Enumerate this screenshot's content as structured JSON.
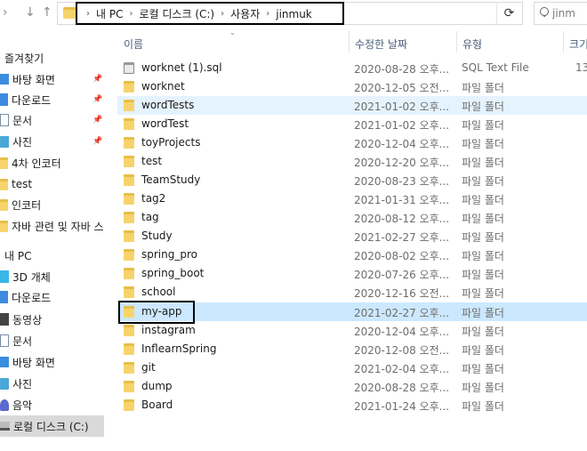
{
  "address_bar": {
    "crumbs": [
      "내 PC",
      "로컬 디스크 (C:)",
      "사용자",
      "jinmuk"
    ],
    "search_placeholder": "jinm"
  },
  "sidebar": {
    "items": [
      {
        "label": "즐겨찾기",
        "icon": "star-icon",
        "pinned": false
      },
      {
        "label": "바탕 화면",
        "icon": "desktop-icon",
        "pinned": true
      },
      {
        "label": "다운로드",
        "icon": "download-icon",
        "pinned": true
      },
      {
        "label": "문서",
        "icon": "document-icon",
        "pinned": true
      },
      {
        "label": "사진",
        "icon": "pictures-icon",
        "pinned": true
      },
      {
        "label": "4차 인코터",
        "icon": "folder-icon",
        "pinned": false
      },
      {
        "label": "test",
        "icon": "folder-icon",
        "pinned": false
      },
      {
        "label": "인코터",
        "icon": "folder-icon",
        "pinned": false
      },
      {
        "label": "자바 관련 및 자바 스",
        "icon": "folder-icon",
        "pinned": false
      },
      {
        "label": "내 PC",
        "icon": "pc-icon",
        "pinned": false
      },
      {
        "label": "3D 개체",
        "icon": "3d-objects-icon",
        "pinned": false
      },
      {
        "label": "다운로드",
        "icon": "download-icon",
        "pinned": false
      },
      {
        "label": "동영상",
        "icon": "video-icon",
        "pinned": false
      },
      {
        "label": "문서",
        "icon": "document-icon",
        "pinned": false
      },
      {
        "label": "바탕 화면",
        "icon": "desktop-icon",
        "pinned": false
      },
      {
        "label": "사진",
        "icon": "pictures-icon",
        "pinned": false
      },
      {
        "label": "음악",
        "icon": "music-icon",
        "pinned": false
      },
      {
        "label": "로컬 디스크 (C:)",
        "icon": "drive-icon",
        "pinned": false,
        "selected": true
      }
    ]
  },
  "columns": {
    "name": "이름",
    "date": "수정한 날짜",
    "type": "유형",
    "size": "크기"
  },
  "files": [
    {
      "name": "worknet (1).sql",
      "date": "2020-08-28 오후...",
      "type": "SQL Text File",
      "size": "13",
      "kind": "sql"
    },
    {
      "name": "worknet",
      "date": "2020-12-05 오전...",
      "type": "파일 폴더",
      "size": "",
      "kind": "folder"
    },
    {
      "name": "wordTests",
      "date": "2021-01-02 오후...",
      "type": "파일 폴더",
      "size": "",
      "kind": "folder",
      "state": "hover"
    },
    {
      "name": "wordTest",
      "date": "2021-01-02 오후...",
      "type": "파일 폴더",
      "size": "",
      "kind": "folder"
    },
    {
      "name": "toyProjects",
      "date": "2020-12-04 오후...",
      "type": "파일 폴더",
      "size": "",
      "kind": "folder"
    },
    {
      "name": "test",
      "date": "2020-12-20 오후...",
      "type": "파일 폴더",
      "size": "",
      "kind": "folder"
    },
    {
      "name": "TeamStudy",
      "date": "2020-08-23 오후...",
      "type": "파일 폴더",
      "size": "",
      "kind": "folder"
    },
    {
      "name": "tag2",
      "date": "2021-01-31 오후...",
      "type": "파일 폴더",
      "size": "",
      "kind": "folder"
    },
    {
      "name": "tag",
      "date": "2020-08-12 오후...",
      "type": "파일 폴더",
      "size": "",
      "kind": "folder"
    },
    {
      "name": "Study",
      "date": "2021-02-27 오후...",
      "type": "파일 폴더",
      "size": "",
      "kind": "folder"
    },
    {
      "name": "spring_pro",
      "date": "2020-08-02 오후...",
      "type": "파일 폴더",
      "size": "",
      "kind": "folder"
    },
    {
      "name": "spring_boot",
      "date": "2020-07-26 오후...",
      "type": "파일 폴더",
      "size": "",
      "kind": "folder"
    },
    {
      "name": "school",
      "date": "2020-12-16 오전...",
      "type": "파일 폴더",
      "size": "",
      "kind": "folder"
    },
    {
      "name": "my-app",
      "date": "2021-02-27 오후...",
      "type": "파일 폴더",
      "size": "",
      "kind": "folder",
      "state": "selected"
    },
    {
      "name": "instagram",
      "date": "2020-12-04 오후...",
      "type": "파일 폴더",
      "size": "",
      "kind": "folder"
    },
    {
      "name": "InflearnSpring",
      "date": "2020-12-08 오전...",
      "type": "파일 폴더",
      "size": "",
      "kind": "folder"
    },
    {
      "name": "git",
      "date": "2021-02-04 오후...",
      "type": "파일 폴더",
      "size": "",
      "kind": "folder"
    },
    {
      "name": "dump",
      "date": "2020-08-28 오후...",
      "type": "파일 폴더",
      "size": "",
      "kind": "folder"
    },
    {
      "name": "Board",
      "date": "2021-01-24 오후...",
      "type": "파일 폴더",
      "size": "",
      "kind": "folder"
    }
  ]
}
